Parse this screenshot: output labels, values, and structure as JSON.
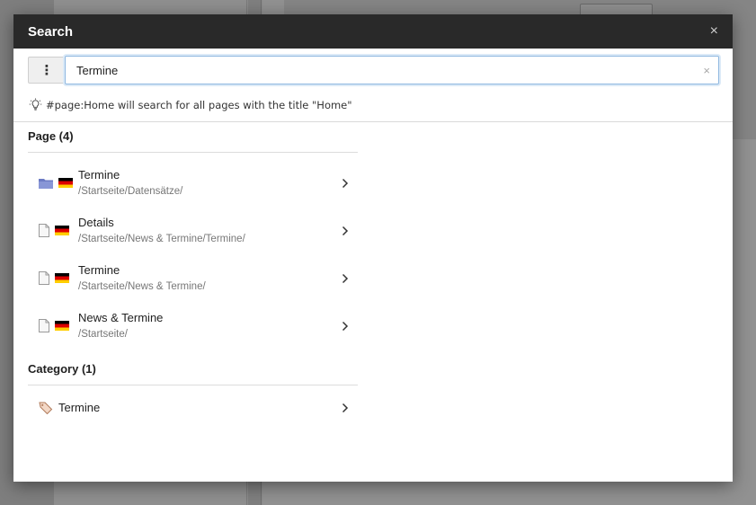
{
  "modal": {
    "title": "Search",
    "close_symbol": "×"
  },
  "search": {
    "options_symbol": "⋮",
    "value": "Termine",
    "clear_symbol": "×"
  },
  "hint": {
    "text": "#page:Home will search for all pages with the title \"Home\"",
    "icon": "lightbulb-icon"
  },
  "results": {
    "page_group": {
      "header": "Page (4)",
      "items": [
        {
          "title": "Termine",
          "path": "/Startseite/Datensätze/",
          "icon": "folder-icon",
          "flag": "german-flag"
        },
        {
          "title": "Details",
          "path": "/Startseite/News & Termine/Termine/",
          "icon": "page-icon",
          "flag": "german-flag"
        },
        {
          "title": "Termine",
          "path": "/Startseite/News & Termine/",
          "icon": "page-icon",
          "flag": "german-flag"
        },
        {
          "title": "News & Termine",
          "path": "/Startseite/",
          "icon": "page-icon",
          "flag": "german-flag"
        }
      ]
    },
    "category_group": {
      "header": "Category (1)",
      "items": [
        {
          "title": "Termine",
          "icon": "tag-icon"
        }
      ]
    }
  },
  "colors": {
    "header_bg": "#292929",
    "input_focus": "#8fb8e0",
    "folder": "#6c7bc4"
  }
}
